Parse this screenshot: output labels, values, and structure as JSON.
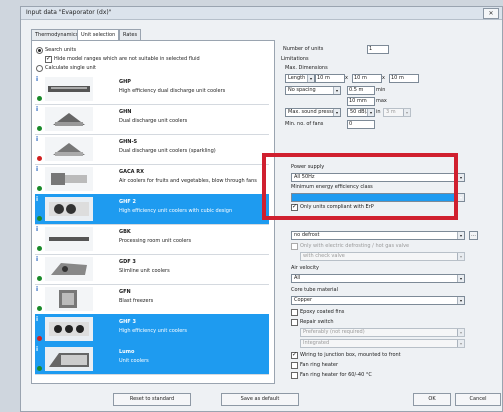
{
  "window": {
    "title": "Input data \"Evaporator (dx)\""
  },
  "tabs": [
    {
      "label": "Thermodynamics"
    },
    {
      "label": "Unit selection"
    },
    {
      "label": "Rates"
    }
  ],
  "left": {
    "search_units": "Search units",
    "hide_models": "Hide model ranges which are not suitable in selected fluid",
    "calculate_single": "Calculate single unit"
  },
  "units": [
    {
      "name": "GHP",
      "desc": "High efficiency dual discharge unit coolers",
      "status": "#1a8a2a"
    },
    {
      "name": "GHN",
      "desc": "Dual discharge unit coolers",
      "status": "#1a8a2a"
    },
    {
      "name": "GHN-S",
      "desc": "Dual discharge unit coolers (sparkling)",
      "status": "#d02020"
    },
    {
      "name": "GACA RX",
      "desc": "Air coolers for fruits and vegetables, blow through fans",
      "status": "#1a8a2a"
    },
    {
      "name": "GHF 2",
      "desc": "High efficiency unit coolers with cubic design",
      "status": "#1a8a2a"
    },
    {
      "name": "GBK",
      "desc": "Processing room unit coolers",
      "status": "#1a8a2a"
    },
    {
      "name": "GDF 3",
      "desc": "Slimline unit coolers",
      "status": "#1a8a2a"
    },
    {
      "name": "GFN",
      "desc": "Blast freezers",
      "status": "#1a8a2a"
    },
    {
      "name": "GHF 3",
      "desc": "High efficiency unit coolers",
      "status": "#d02020"
    },
    {
      "name": "Lumo",
      "desc": "Unit coolers",
      "status": "#1a8a2a"
    }
  ],
  "right": {
    "number_of_units_label": "Number of units",
    "number_of_units_value": "1",
    "limitations_label": "Limitations",
    "max_dimensions_label": "Max. Dimensions",
    "length_label": "Length",
    "length_value": "10 m",
    "width_value": "10 m",
    "height_value": "10 m",
    "spacing_value": "No spacing",
    "spacing_m": "0.5 m",
    "spacing_unit": "min",
    "max_label": "10 mm",
    "max_unit": "max",
    "sound_value": "Max. sound pressure",
    "sound_db": "50 dB(A)",
    "sound_dist": "3 m",
    "no_fans_label": "Min. no. of fans",
    "no_fans_value": "0",
    "power_supply_label": "Power supply",
    "power_supply_value": "All 50Hz",
    "eff_class_label": "Minimum energy efficiency class",
    "eff_class_value": "",
    "erp_label": "Only units compliant with ErP",
    "defrost_value": "no defrost",
    "defrost_valve_label": "Only with electric defrosting / hot gas valve",
    "defrost_valve_value": "with check valve",
    "air_velocity_label": "Air velocity",
    "air_velocity_value": "All",
    "core_tube_label": "Core tube material",
    "core_tube_value": "Copper",
    "epoxy_label": "Epoxy coated fins",
    "repair_switch_label": "Repair switch",
    "repair_1": "Preferably (not required)",
    "repair_2": "Integrated",
    "wiring_label": "Wiring to junction box, mounted to front",
    "fan_ring_label": "Fan ring heater",
    "fan_ring_40_label": "Fan ring heater for 60/-40 °C"
  },
  "buttons": {
    "reset": "Reset to standard",
    "save": "Save as default",
    "ok": "OK",
    "cancel": "Cancel"
  },
  "icons": [
    "close-icon",
    "info-icon",
    "status-dot-icon",
    "dropdown-arrow-icon",
    "ellipsis-icon"
  ]
}
